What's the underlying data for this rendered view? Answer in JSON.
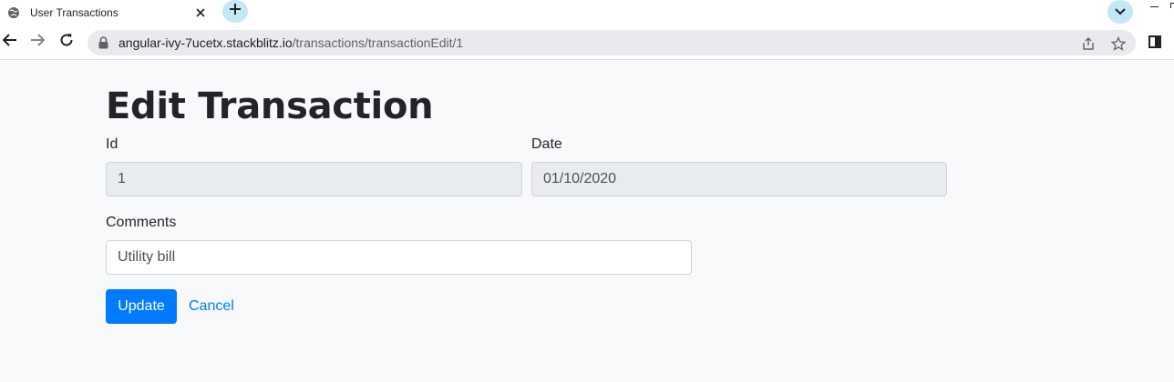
{
  "browser": {
    "tab_title": "User Transactions",
    "url_host": "angular-ivy-7ucetx.stackblitz.io",
    "url_path": "/transactions/transactionEdit/1"
  },
  "page": {
    "title": "Edit Transaction",
    "id_label": "Id",
    "id_value": "1",
    "date_label": "Date",
    "date_value": "01/10/2020",
    "comments_label": "Comments",
    "comments_value": "Utility bill",
    "update_label": "Update",
    "cancel_label": "Cancel"
  },
  "colors": {
    "primary": "#007bff",
    "readonly_bg": "#e9ecef",
    "page_bg": "#f8f9fa",
    "accent_chip": "#c2e7f5"
  },
  "icons": [
    "globe-icon",
    "close-icon",
    "plus-icon",
    "chevron-down-icon",
    "back-arrow-icon",
    "forward-arrow-icon",
    "reload-icon",
    "lock-icon",
    "share-icon",
    "star-icon",
    "side-panel-icon"
  ]
}
